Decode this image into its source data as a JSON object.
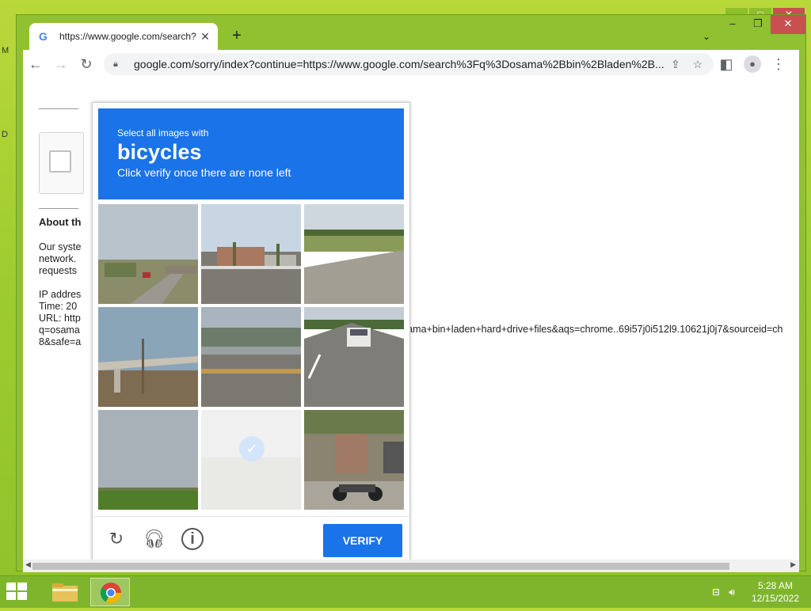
{
  "desktop": {
    "edge_letters": [
      "M",
      "D"
    ]
  },
  "window": {
    "tab_title": "https://www.google.com/search?",
    "favicon": "G",
    "address_url": "google.com/sorry/index?continue=https://www.google.com/search%3Fq%3Dosama%2Bbin%2Bladen%2B..."
  },
  "page": {
    "about_heading": "About th",
    "para1": [
      "Our syste",
      "network.",
      "requests"
    ],
    "para2": [
      "IP addres",
      "Time: 20",
      "URL: http",
      "q=osama",
      "8&safe=a"
    ],
    "url_tail": "osama+bin+laden+hard+drive+files&aqs=chrome..69i57j0i512l9.10621j0j7&sourceid=ch"
  },
  "captcha": {
    "instruction_line1": "Select all images with",
    "target_word": "bicycles",
    "instruction_line3": "Click verify once there are none left",
    "verify_label": "VERIFY",
    "tiles": [
      {
        "scene": "street-scene",
        "selected": false
      },
      {
        "scene": "building-scene",
        "selected": false
      },
      {
        "scene": "highway-field-scene",
        "selected": false
      },
      {
        "scene": "overpass-scene",
        "selected": false
      },
      {
        "scene": "bridge-road-scene",
        "selected": false
      },
      {
        "scene": "road-truck-scene",
        "selected": false
      },
      {
        "scene": "sky-field-scene",
        "selected": false
      },
      {
        "scene": "selected-faded-tile",
        "selected": true
      },
      {
        "scene": "motorcycle-street-scene",
        "selected": false
      }
    ],
    "footer_icons": [
      "reload-icon",
      "headphones-icon",
      "info-icon"
    ]
  },
  "taskbar": {
    "time": "5:28 AM",
    "date": "12/15/2022",
    "apps": [
      "file-explorer-icon",
      "chrome-icon"
    ]
  },
  "colors": {
    "accent": "#1a73e8",
    "desktop": "#9ccb2f",
    "close": "#c75050"
  }
}
